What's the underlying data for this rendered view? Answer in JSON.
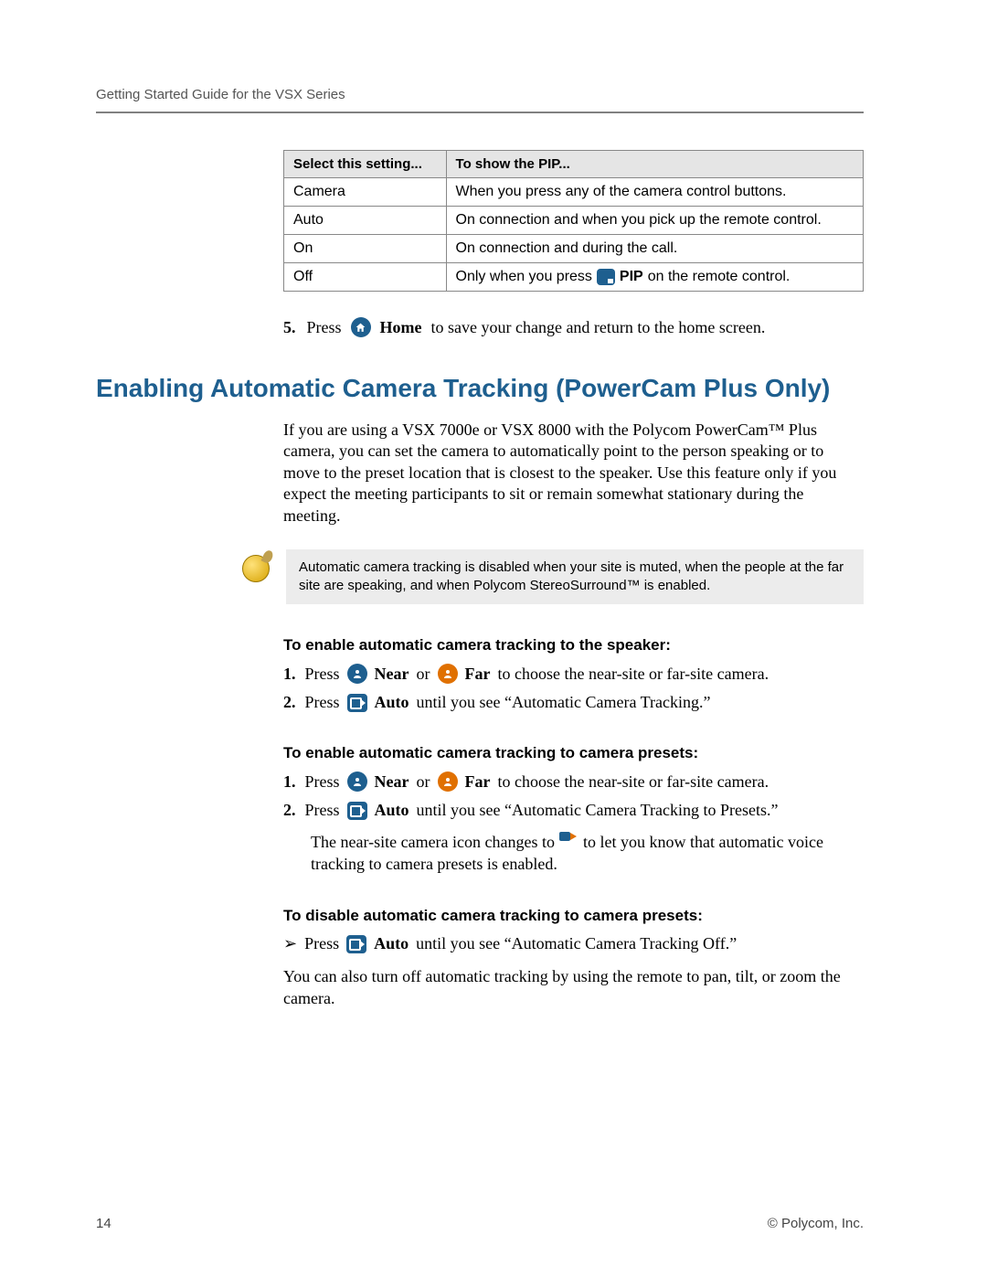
{
  "header": "Getting Started Guide for the VSX Series",
  "table": {
    "headers": [
      "Select this setting...",
      "To show the PIP..."
    ],
    "rows": [
      {
        "setting": "Camera",
        "desc": "When you press any of the camera control buttons."
      },
      {
        "setting": "Auto",
        "desc": "On connection and when you pick up the remote control."
      },
      {
        "setting": "On",
        "desc": "On connection and during the call."
      },
      {
        "setting": "Off",
        "desc_prefix": "Only when you press ",
        "desc_bold": "PIP",
        "desc_suffix": " on the remote control."
      }
    ]
  },
  "step5": {
    "num": "5.",
    "prefix": "Press ",
    "button": "Home",
    "rest": " to save your change and return to the home screen."
  },
  "section_title": "Enabling Automatic Camera Tracking (PowerCam Plus Only)",
  "intro": "If you are using a VSX 7000e or VSX 8000 with the Polycom PowerCam™ Plus camera, you can set the camera to automatically point to the person speaking or to move to the preset location that is closest to the speaker. Use this feature only if you expect the meeting participants to sit or remain somewhat stationary during the meeting.",
  "note": "Automatic camera tracking is disabled when your site is muted, when the people at the far site are speaking, and when Polycom StereoSurround™ is enabled.",
  "speaker": {
    "heading": "To enable automatic camera tracking to the speaker:",
    "items": [
      {
        "num": "1.",
        "p1": "Press ",
        "b1": "Near",
        "mid": " or ",
        "b2": "Far",
        "rest": " to choose the near-site or far-site camera."
      },
      {
        "num": "2.",
        "p1": "Press ",
        "b1": "Auto",
        "rest": " until you see  “Automatic Camera Tracking.”"
      }
    ]
  },
  "presets": {
    "heading": "To enable automatic camera tracking to camera presets:",
    "items": [
      {
        "num": "1.",
        "p1": "Press ",
        "b1": "Near",
        "mid": " or ",
        "b2": "Far",
        "rest": " to choose the near-site or far-site camera."
      },
      {
        "num": "2.",
        "p1": "Press ",
        "b1": "Auto",
        "rest": " until you see “Automatic Camera Tracking to Presets.”"
      }
    ],
    "extra_a": "The near-site camera icon changes to ",
    "extra_b": " to let you know that automatic voice tracking to camera presets is enabled."
  },
  "disable": {
    "heading": "To disable automatic camera tracking to camera presets:",
    "p1": "Press ",
    "b1": "Auto",
    "rest": " until you see “Automatic Camera Tracking Off.”",
    "closing": "You can also turn off automatic tracking by using the remote to pan, tilt, or zoom the camera."
  },
  "footer": {
    "page": "14",
    "copyright": "© Polycom, Inc."
  }
}
